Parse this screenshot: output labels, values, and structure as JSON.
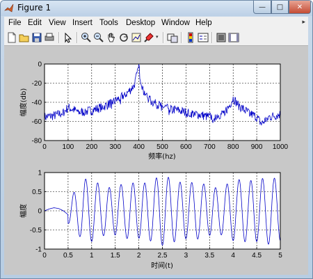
{
  "window": {
    "title": "Figure 1",
    "minimize_label": "—",
    "maximize_label": "□",
    "close_label": "✕"
  },
  "menu": {
    "items": [
      "File",
      "Edit",
      "View",
      "Insert",
      "Tools",
      "Desktop",
      "Window",
      "Help"
    ],
    "overflow_arrow": "▸"
  },
  "toolbar": {
    "buttons": [
      "new-figure",
      "open-file",
      "save-figure",
      "print-figure",
      "edit-plot",
      "zoom-in",
      "zoom-out",
      "pan",
      "rotate-3d",
      "data-cursor",
      "brush",
      "link-plot",
      "insert-colorbar",
      "insert-legend",
      "hide-plot-tools",
      "show-plot-tools"
    ]
  },
  "colors": {
    "line": "#0000c8",
    "axes_bg": "#ffffff",
    "figure_bg": "#c8c8c8"
  },
  "chart_data": [
    {
      "type": "line",
      "xlabel": "频率(hz)",
      "ylabel": "幅度(db)",
      "xlim": [
        0,
        1000
      ],
      "ylim": [
        -80,
        0
      ],
      "xticks": [
        0,
        100,
        200,
        300,
        400,
        500,
        600,
        700,
        800,
        900,
        1000
      ],
      "yticks": [
        -80,
        -60,
        -40,
        -20,
        0
      ],
      "grid": "dashed",
      "series": [
        {
          "x": [
            0,
            50,
            80,
            100,
            150,
            200,
            250,
            300,
            350,
            380,
            395,
            400,
            405,
            420,
            450,
            500,
            550,
            600,
            650,
            700,
            750,
            780,
            800,
            820,
            850,
            900,
            920,
            950,
            1000
          ],
          "y": [
            -55,
            -53,
            -50,
            -45,
            -50,
            -48,
            -44,
            -38,
            -30,
            -22,
            -8,
            -2,
            -12,
            -28,
            -38,
            -44,
            -47,
            -50,
            -52,
            -55,
            -52,
            -45,
            -35,
            -42,
            -48,
            -55,
            -62,
            -55,
            -52
          ]
        }
      ]
    },
    {
      "type": "line",
      "xlabel": "时间(t)",
      "ylabel": "幅度",
      "xlim": [
        0,
        5
      ],
      "ylim": [
        -1,
        1
      ],
      "xticks": [
        0,
        0.5,
        1,
        1.5,
        2,
        2.5,
        3,
        3.5,
        4,
        4.5,
        5
      ],
      "yticks": [
        -1,
        -0.5,
        0,
        0.5,
        1
      ],
      "grid": "dashed",
      "series": [
        {
          "frequency_hz": 4,
          "amplitude": 0.75,
          "onset_t": 0.5,
          "x": [
            0,
            0.1,
            0.2,
            0.3,
            0.4,
            0.5,
            0.55
          ],
          "y": [
            0,
            0.05,
            0.08,
            0.06,
            0.0,
            -0.1,
            -0.25
          ]
        }
      ]
    }
  ]
}
